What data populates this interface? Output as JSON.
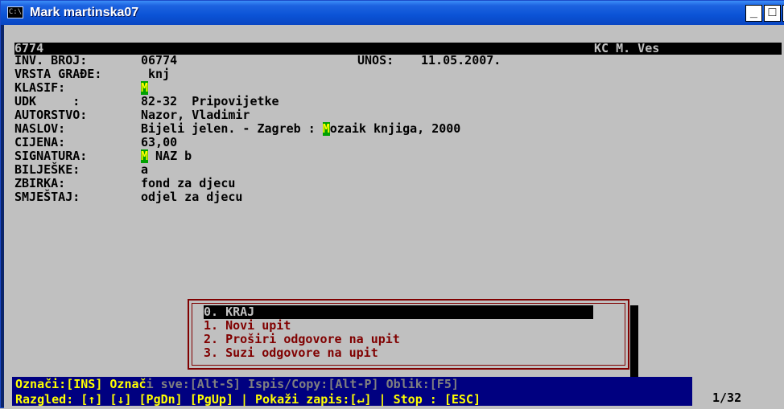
{
  "window": {
    "title": "Mark martinska07",
    "icon_text": "C:\\",
    "buttons": {
      "minimize": "_",
      "maximize": "□",
      "close": "×"
    }
  },
  "record": {
    "id": "6774",
    "library": "KČ M. Ves",
    "inv_label": "INV. BROJ:",
    "inv_value": "06774",
    "unos_label": "UNOS:",
    "unos_value": "11.05.2007.",
    "vrsta_label": "VRSTA GRAĐE:",
    "vrsta_value": "knj",
    "klasif_label": "KLASIF:",
    "klasif_marker": "M",
    "udk_label": "UDK     :",
    "udk_value": "82-32  Pripovijetke",
    "autorstvo_label": "AUTORSTVO:",
    "autorstvo_value": "Nazor, Vladimir",
    "naslov_label": "NASLOV:",
    "naslov_value_pre": "Bijeli jelen. - Zagreb : ",
    "naslov_marker": "M",
    "naslov_value_post": "ozaik knjiga, 2000",
    "cijena_label": "CIJENA:",
    "cijena_value": "63,00",
    "signatura_label": "SIGNATURA:",
    "signatura_marker": "M",
    "signatura_value": " NAZ b",
    "biljeske_label": "BILJEŠKE:",
    "biljeske_value": "a",
    "zbirka_label": "ZBIRKA:",
    "zbirka_value": "fond za djecu",
    "smjestaj_label": "SMJEŠTAJ:",
    "smjestaj_value": "odjel za djecu"
  },
  "menu": {
    "items": [
      "0. KRAJ",
      "1. Novi upit",
      "2. Proširi odgovore na upit",
      "3. Suzi odgovore na upit"
    ],
    "selected_index": 0
  },
  "status": {
    "line1_a": "Označi:[INS] Označ",
    "line1_b": "i sve:[Alt-S] Ispis/Copy:[Alt-P] Oblik:[F5]",
    "line2": "Razgled: [↑] [↓] [PgDn] [PgUp] | Pokaži zapis:[↵] | Stop : [ESC]",
    "page": "1/32"
  },
  "colors": {
    "titlebar": "#0b53d6",
    "console_bg": "#c0c0c0",
    "menu_text": "#800000",
    "status_bg": "#000080",
    "status_text": "#ffff00",
    "marker_bg": "#00a000"
  }
}
